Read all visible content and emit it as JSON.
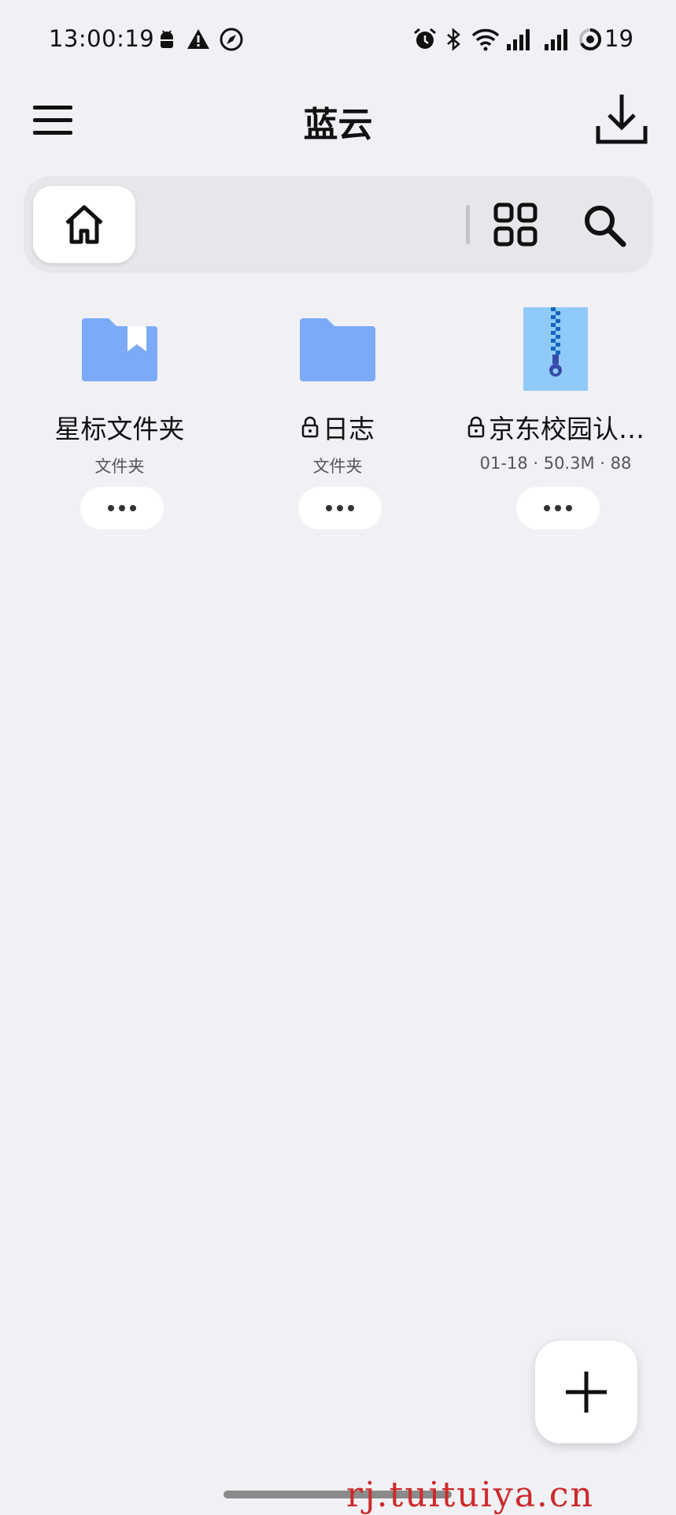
{
  "status_bar": {
    "time": "13:00:19",
    "battery": "19",
    "icons": [
      "android-icon",
      "warning-icon",
      "compass-icon",
      "alarm-icon",
      "bluetooth-icon",
      "wifi-icon",
      "signal-icon",
      "signal-icon",
      "battery-ring-icon"
    ]
  },
  "app_bar": {
    "title": "蓝云",
    "menu_icon": "menu-icon",
    "download_icon": "download-icon"
  },
  "path_bar": {
    "home_icon": "home-icon",
    "grid_icon": "grid-view-icon",
    "search_icon": "search-icon"
  },
  "files": [
    {
      "name": "星标文件夹",
      "meta": "文件夹",
      "type": "starred-folder",
      "locked": false
    },
    {
      "name": "日志",
      "meta": "文件夹",
      "type": "folder",
      "locked": true
    },
    {
      "name": "京东校园认…",
      "meta": "01-18 · 50.3M · 88",
      "type": "archive",
      "locked": true
    }
  ],
  "colors": {
    "background": "#f1f0f5",
    "folder": "#7baaf7",
    "archive": "#90caf9",
    "zipper": "#1565c0"
  },
  "watermark": "rj.tuituiya.cn"
}
